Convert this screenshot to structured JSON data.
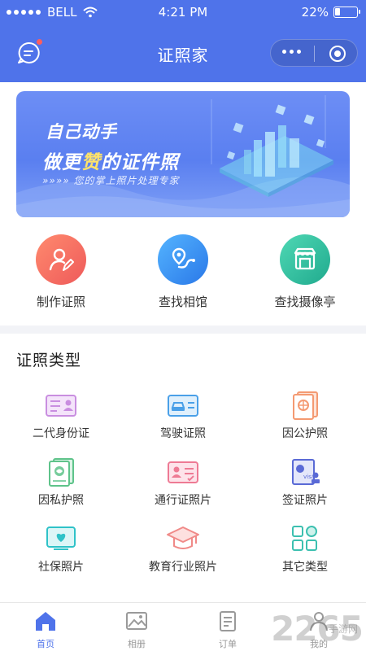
{
  "status_bar": {
    "carrier": "BELL",
    "time": "4:21 PM",
    "battery": "22%",
    "battery_level": 0.22,
    "signal_icon": "signal-dots-icon",
    "wifi_icon": "wifi-icon"
  },
  "header": {
    "title": "证照家",
    "message_icon": "message-icon",
    "more_icon": "more-dots-icon",
    "close_icon": "target-circle-icon"
  },
  "banner": {
    "line1": "自己动手",
    "line2_prefix": "做更",
    "line2_accent": "赞",
    "line2_suffix": "的证件照",
    "line3": "»»»» 您的掌上照片处理专家"
  },
  "quick_actions": [
    {
      "label": "制作证照",
      "icon": "person-pen-icon",
      "color": "#f0705a"
    },
    {
      "label": "查找相馆",
      "icon": "map-pin-icon",
      "color": "#3d8cf0"
    },
    {
      "label": "查找摄像亭",
      "icon": "kiosk-icon",
      "color": "#2ec0a0"
    }
  ],
  "section": {
    "title": "证照类型"
  },
  "types": [
    {
      "label": "二代身份证",
      "icon": "id-card-icon",
      "color": "#c98ee0"
    },
    {
      "label": "驾驶证照",
      "icon": "car-license-icon",
      "color": "#4aa0e8"
    },
    {
      "label": "因公护照",
      "icon": "official-passport-icon",
      "color": "#f49a72"
    },
    {
      "label": "因私护照",
      "icon": "private-passport-icon",
      "color": "#5ec38a"
    },
    {
      "label": "通行证照片",
      "icon": "pass-card-icon",
      "color": "#ee7a94"
    },
    {
      "label": "签证照片",
      "icon": "visa-icon",
      "color": "#5a6ad6"
    },
    {
      "label": "社保照片",
      "icon": "social-security-icon",
      "color": "#2fc2c8"
    },
    {
      "label": "教育行业照片",
      "icon": "graduation-cap-icon",
      "color": "#f08a88"
    },
    {
      "label": "其它类型",
      "icon": "grid-apps-icon",
      "color": "#3cc0b0"
    }
  ],
  "tabbar": {
    "items": [
      {
        "label": "首页",
        "icon": "home-icon",
        "active": true
      },
      {
        "label": "相册",
        "icon": "album-icon",
        "active": false
      },
      {
        "label": "订单",
        "icon": "order-icon",
        "active": false
      },
      {
        "label": "我的",
        "icon": "profile-icon",
        "active": false
      }
    ]
  },
  "watermark": {
    "text": "2265",
    "sub": "手游网"
  },
  "colors": {
    "primary": "#4f73ea",
    "tab_active": "#4f73ea",
    "badge_red": "#ff5d5d"
  }
}
